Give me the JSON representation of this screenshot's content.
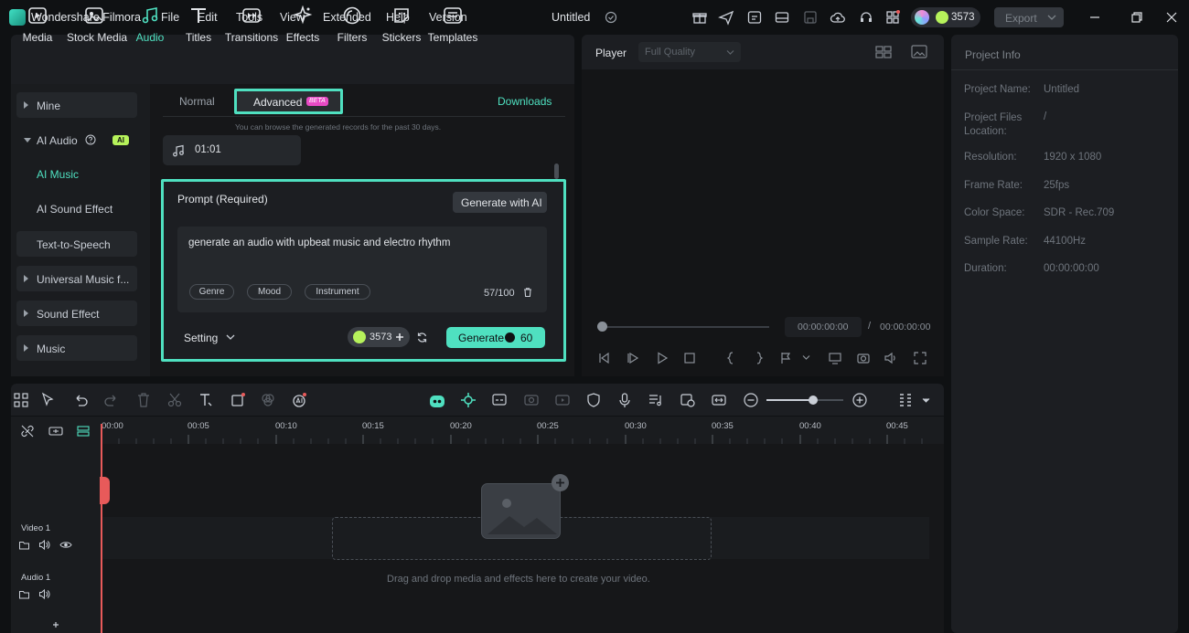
{
  "app": {
    "name": "Wondershare Filmora",
    "doc_title": "Untitled",
    "credits": "3573",
    "export_label": "Export"
  },
  "menu": [
    "File",
    "Edit",
    "Tools",
    "View",
    "Extended",
    "Help",
    "Version"
  ],
  "tabs": [
    "Media",
    "Stock Media",
    "Audio",
    "Titles",
    "Transitions",
    "Effects",
    "Filters",
    "Stickers",
    "Templates"
  ],
  "active_tab": "Audio",
  "sidebar": {
    "mine": "Mine",
    "ai_audio": "AI Audio",
    "ai_badge": "AI",
    "ai_music": "AI Music",
    "ai_sound_effect": "AI Sound Effect",
    "tts": "Text-to-Speech",
    "universal": "Universal Music f...",
    "sound_effect": "Sound Effect",
    "music": "Music"
  },
  "modes": {
    "normal": "Normal",
    "advanced": "Advanced",
    "beta": "BETA",
    "downloads": "Downloads"
  },
  "history_note": "You can browse the generated records for the past 30 days.",
  "record": {
    "duration": "01:01"
  },
  "prompt": {
    "label": "Prompt (Required)",
    "gen_ai": "Generate with AI",
    "text": "generate  an audio with upbeat music and electro rhythm",
    "chips": [
      "Genre",
      "Mood",
      "Instrument"
    ],
    "count": "57/100",
    "setting": "Setting",
    "credits": "3573",
    "generate": "Generate",
    "cost": "60"
  },
  "player": {
    "label": "Player",
    "quality": "Full Quality",
    "current": "00:00:00:00",
    "separator": "/",
    "total": "00:00:00:00"
  },
  "project_info": {
    "title": "Project Info",
    "rows": [
      {
        "k": "Project Name:",
        "v": "Untitled"
      },
      {
        "k": "Project Files Location:",
        "v": "/"
      },
      {
        "k": "Resolution:",
        "v": "1920 x 1080"
      },
      {
        "k": "Frame Rate:",
        "v": "25fps"
      },
      {
        "k": "Color Space:",
        "v": "SDR - Rec.709"
      },
      {
        "k": "Sample Rate:",
        "v": "44100Hz"
      },
      {
        "k": "Duration:",
        "v": "00:00:00:00"
      }
    ]
  },
  "timeline": {
    "ruler": [
      "00:00",
      "00:05",
      "00:10",
      "00:15",
      "00:20",
      "00:25",
      "00:30",
      "00:35",
      "00:40",
      "00:45"
    ],
    "tracks": {
      "video": "Video 1",
      "audio": "Audio 1"
    },
    "drop_hint": "Drag and drop media and effects here to create your video."
  },
  "colors": {
    "accent": "#4fe0c0",
    "credit": "#b6f25b",
    "beta": "#e84ac4",
    "playhead": "#e85a5a"
  }
}
